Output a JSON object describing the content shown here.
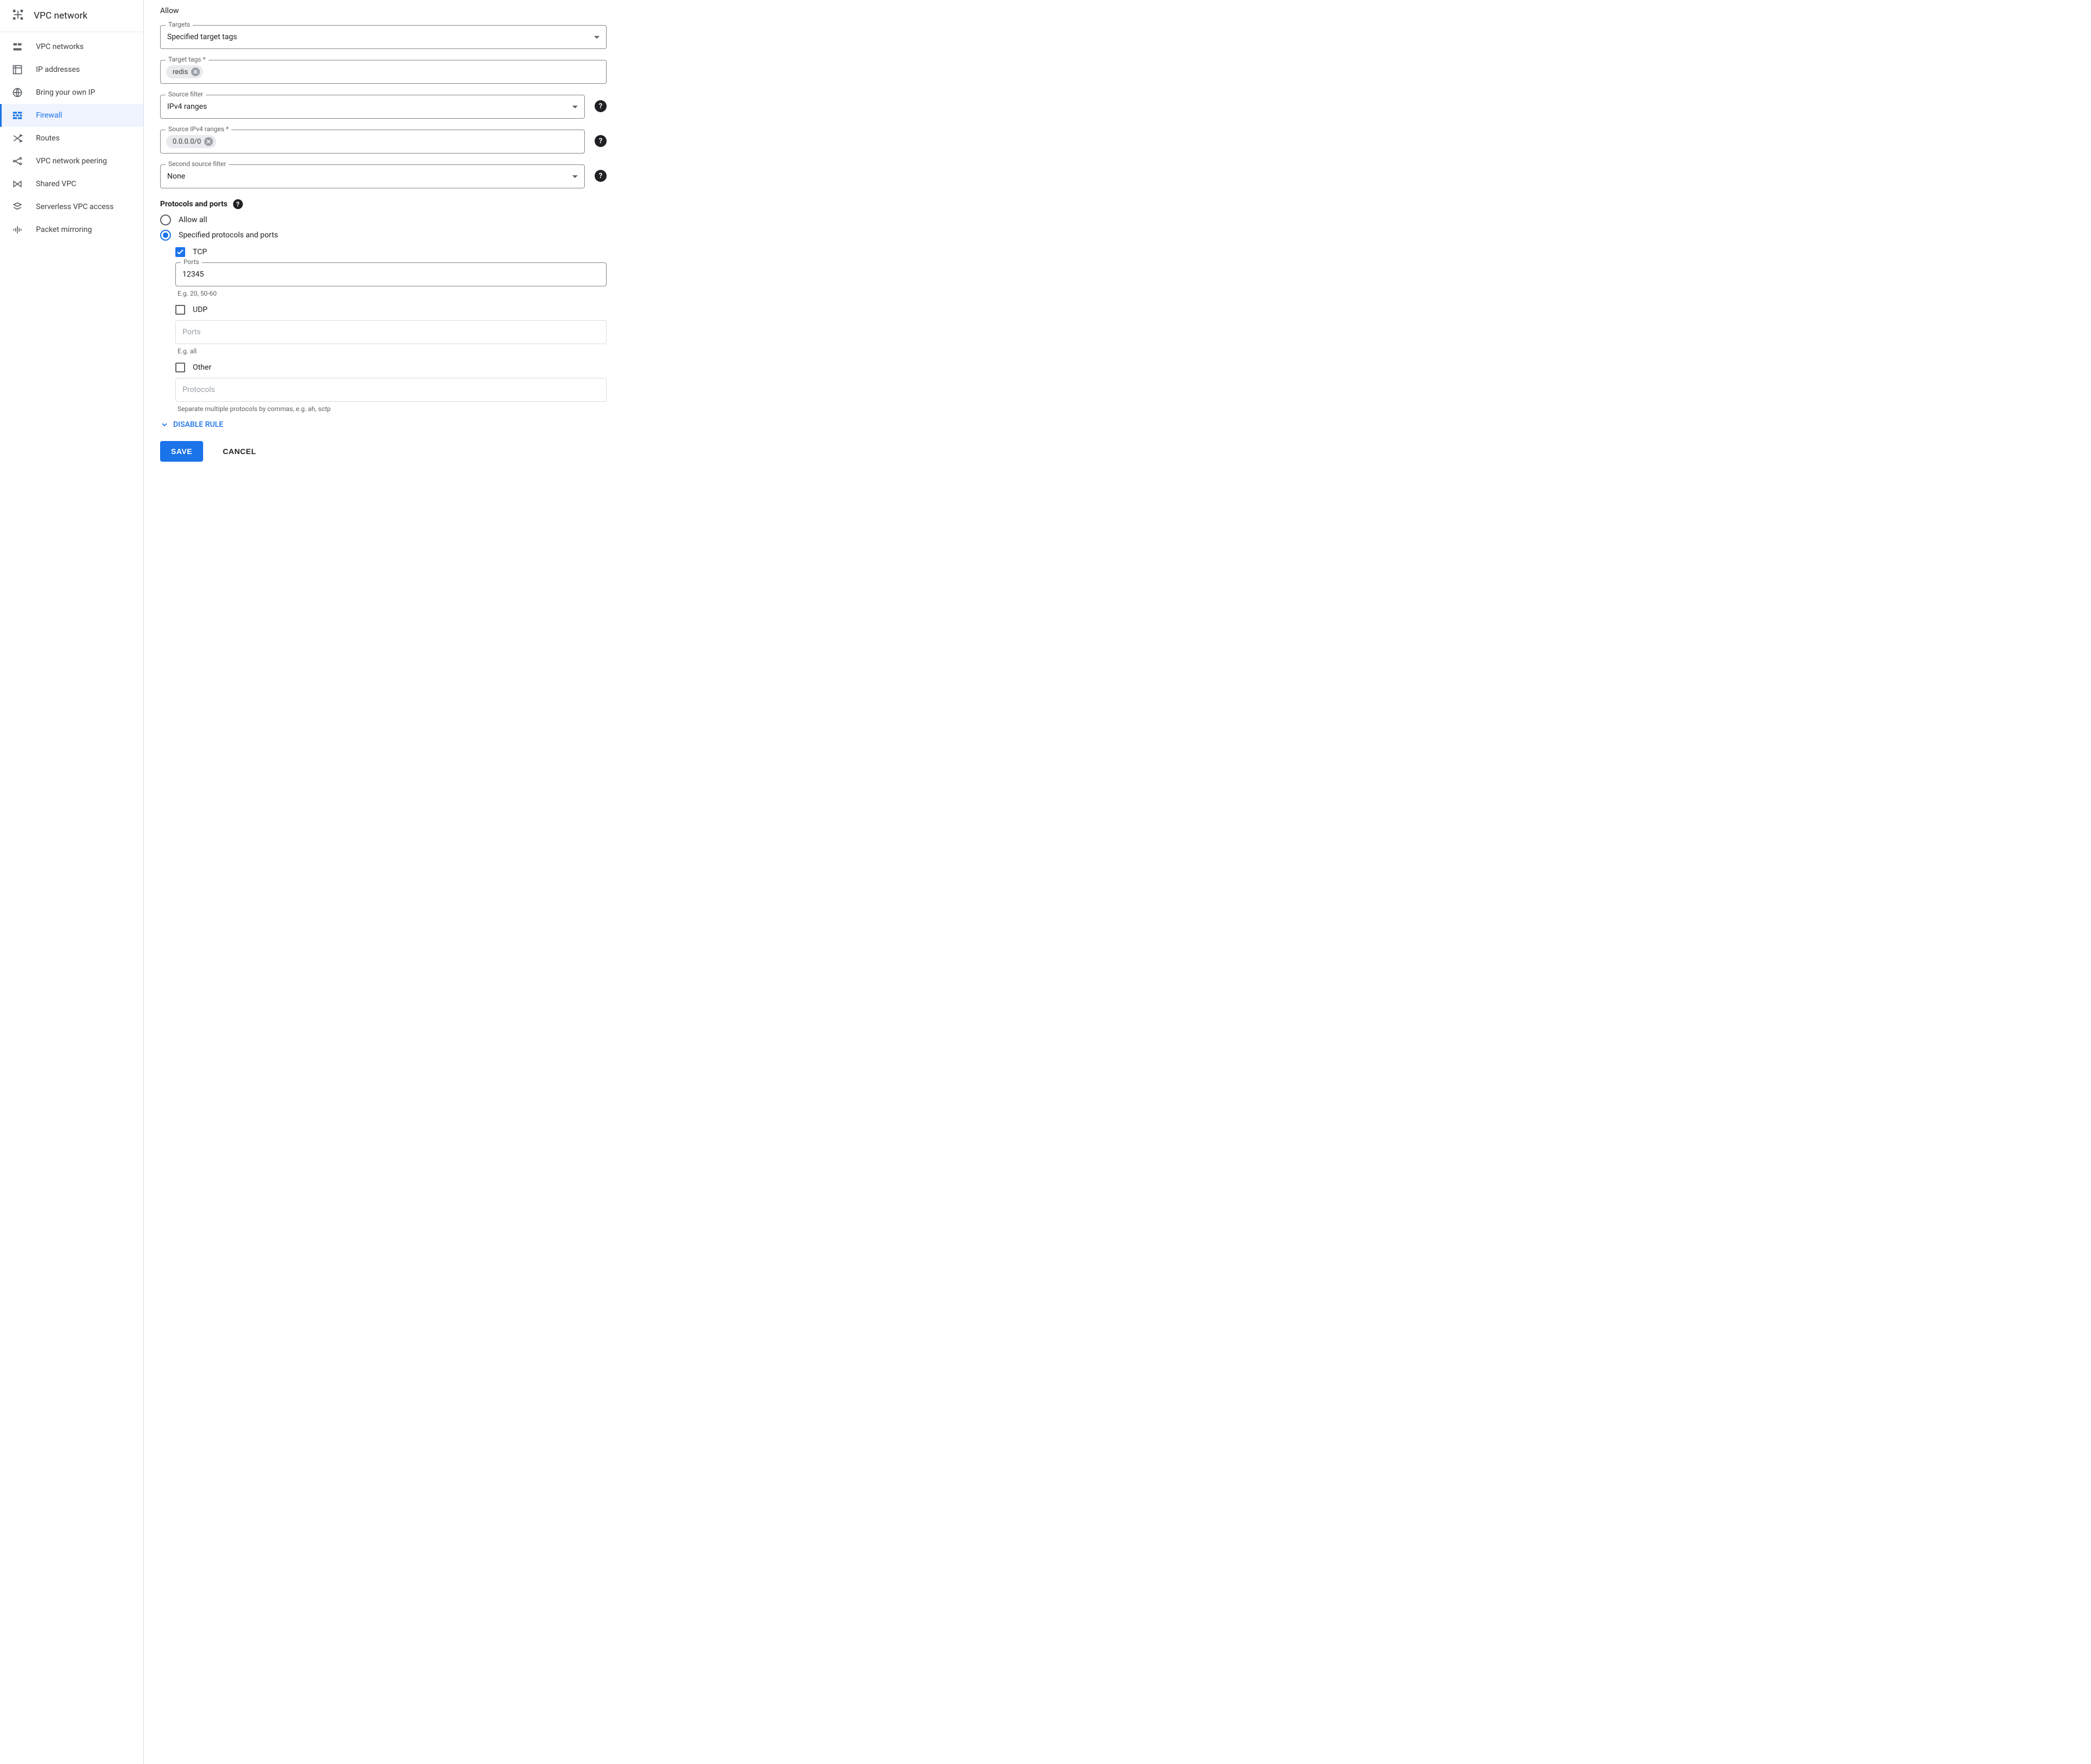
{
  "product": {
    "title": "VPC network"
  },
  "sidebar": {
    "items": [
      {
        "label": "VPC networks"
      },
      {
        "label": "IP addresses"
      },
      {
        "label": "Bring your own IP"
      },
      {
        "label": "Firewall"
      },
      {
        "label": "Routes"
      },
      {
        "label": "VPC network peering"
      },
      {
        "label": "Shared VPC"
      },
      {
        "label": "Serverless VPC access"
      },
      {
        "label": "Packet mirroring"
      }
    ]
  },
  "form": {
    "action_on_match": "Allow",
    "targets": {
      "label": "Targets",
      "value": "Specified target tags"
    },
    "target_tags": {
      "label": "Target tags *",
      "chips": [
        "redis"
      ]
    },
    "source_filter": {
      "label": "Source filter",
      "value": "IPv4 ranges"
    },
    "source_ranges": {
      "label": "Source IPv4 ranges *",
      "chips": [
        "0.0.0.0/0"
      ]
    },
    "second_source_filter": {
      "label": "Second source filter",
      "value": "None"
    },
    "protocols_title": "Protocols and ports",
    "radio": {
      "all": "Allow all",
      "specified": "Specified protocols and ports"
    },
    "tcp": {
      "label": "TCP",
      "ports_label": "Ports",
      "ports_value": "12345",
      "hint": "E.g. 20, 50-60"
    },
    "udp": {
      "label": "UDP",
      "ports_placeholder": "Ports",
      "hint": "E.g. all"
    },
    "other": {
      "label": "Other",
      "protocols_placeholder": "Protocols",
      "hint": "Separate multiple protocols by commas, e.g. ah, sctp"
    },
    "disable_rule": "DISABLE RULE",
    "save": "SAVE",
    "cancel": "CANCEL"
  }
}
